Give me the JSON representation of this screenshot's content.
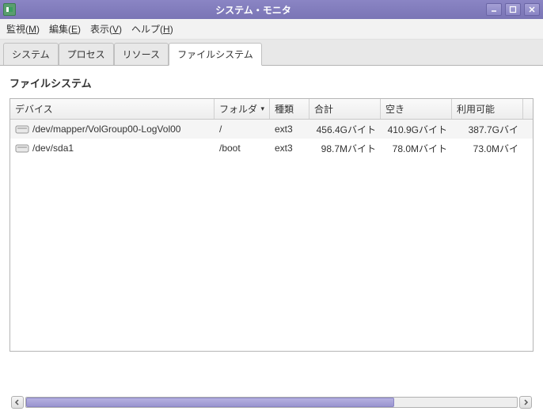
{
  "window": {
    "title": "システム・モニタ"
  },
  "menu": {
    "monitor": "監視(M)",
    "edit": "編集(E)",
    "view": "表示(V)",
    "help": "ヘルプ(H)"
  },
  "tabs": {
    "system": "システム",
    "processes": "プロセス",
    "resources": "リソース",
    "filesystems": "ファイルシステム"
  },
  "section_title": "ファイルシステム",
  "columns": {
    "device": "デバイス",
    "folder": "フォルダ",
    "type": "種類",
    "total": "合計",
    "free": "空き",
    "available": "利用可能"
  },
  "rows": [
    {
      "device": "/dev/mapper/VolGroup00-LogVol00",
      "folder": "/",
      "type": "ext3",
      "total": "456.4Gバイト",
      "free": "410.9Gバイト",
      "available": "387.7Gバイ"
    },
    {
      "device": "/dev/sda1",
      "folder": "/boot",
      "type": "ext3",
      "total": "98.7Mバイト",
      "free": "78.0Mバイト",
      "available": "73.0Mバイ"
    }
  ]
}
